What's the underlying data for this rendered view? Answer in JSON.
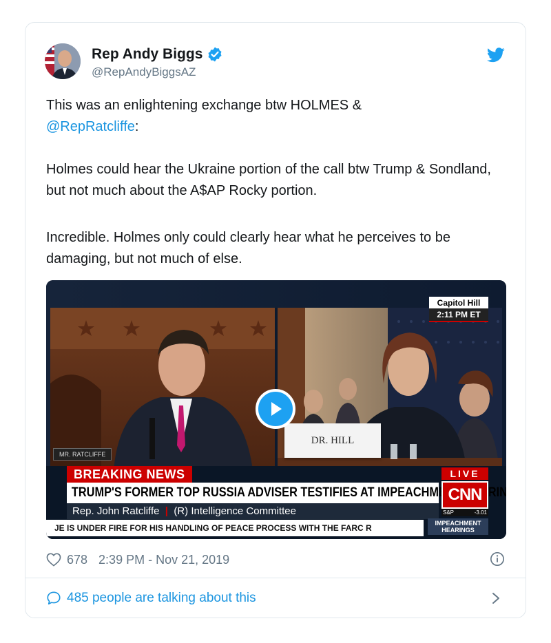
{
  "author": {
    "name": "Rep Andy Biggs",
    "handle": "@RepAndyBiggsAZ",
    "verified": true
  },
  "tweet": {
    "line1_prefix": "This was an enlightening exchange btw HOLMES &",
    "mention": "@RepRatcliffe",
    "mention_suffix": ":",
    "paragraph2": "Holmes could hear the Ukraine portion of the call btw Trump & Sondland, but not much about the A$AP Rocky portion.",
    "paragraph3": "Incredible. Holmes only could clearly hear what he perceives to be damaging, but not much of else."
  },
  "video": {
    "location": "Capitol Hill",
    "time": "2:11 PM ET",
    "nameplate_left": "MR. RATCLIFFE",
    "nameplate_right": "DR. HILL",
    "breaking_label": "BREAKING NEWS",
    "headline": "TRUMP'S FORMER TOP RUSSIA ADVISER TESTIFIES AT IMPEACHMENT HEARING",
    "speaker": "Rep. John Ratcliffe",
    "speaker_role": "(R) Intelligence Committee",
    "ticker": "JE IS UNDER FIRE FOR HIS HANDLING OF PEACE PROCESS WITH THE FARC R",
    "live_label": "LIVE",
    "network": "CNN",
    "market_index": "S&P",
    "market_change": "-3.01",
    "program_line1": "IMPEACHMENT",
    "program_line2": "HEARINGS"
  },
  "meta": {
    "likes": "678",
    "timestamp": "2:39 PM - Nov 21, 2019"
  },
  "conversation": {
    "label": "485 people are talking about this"
  },
  "colors": {
    "link": "#1b95e0",
    "twitter_blue": "#1da1f2",
    "muted": "#657786",
    "cnn_red": "#cc0000"
  },
  "icons": {
    "verified": "verified-badge-icon",
    "brand": "twitter-bird-icon",
    "like": "heart-icon",
    "info": "info-icon",
    "talk": "speech-bubble-icon",
    "more": "chevron-right-icon",
    "play": "play-icon"
  }
}
